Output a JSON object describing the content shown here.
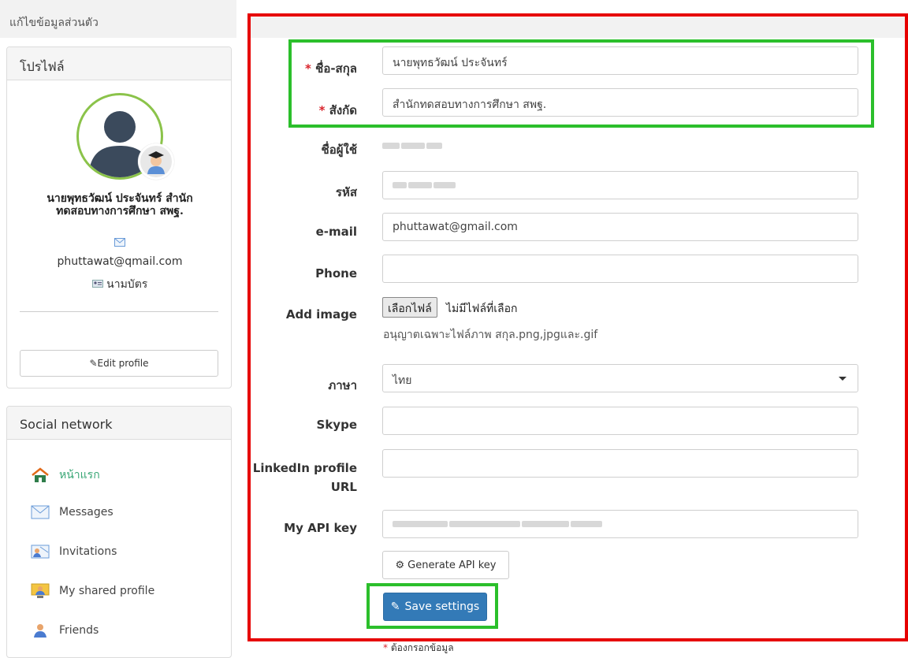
{
  "breadcrumb": "แก้ไขข้อมูลส่วนตัว",
  "profile_panel": {
    "title": "โปรไฟล์",
    "name_line1": "นายพุทธวัฒน์ ประจันทร์ สำนัก",
    "name_line2": "ทดสอบทางการศึกษา สพฐ.",
    "email": "phuttawat@qmail.com",
    "card_label": "นามบัตร",
    "edit_button": "Edit profile"
  },
  "social_panel": {
    "title": "Social network",
    "items": [
      {
        "label": "หน้าแรก",
        "icon": "home-icon"
      },
      {
        "label": "Messages",
        "icon": "envelope-icon"
      },
      {
        "label": "Invitations",
        "icon": "invitation-icon"
      },
      {
        "label": "My shared profile",
        "icon": "shared-profile-icon"
      },
      {
        "label": "Friends",
        "icon": "friends-icon"
      }
    ]
  },
  "form": {
    "fullname": {
      "label": "ชื่อ-สกุล",
      "required_mark": "*",
      "value": "นายพุทธวัฒน์ ประจันทร์"
    },
    "affiliation": {
      "label": "สังกัด",
      "required_mark": "*",
      "value": "สำนักทดสอบทางการศึกษา สพฐ."
    },
    "username": {
      "label": "ชื่อผู้ใช้"
    },
    "password": {
      "label": "รหัส"
    },
    "email": {
      "label": "e-mail",
      "value": "phuttawat@gmail.com"
    },
    "phone": {
      "label": "Phone",
      "value": ""
    },
    "image": {
      "label": "Add image",
      "button": "เลือกไฟล์",
      "status": "ไม่มีไฟล์ที่เลือก",
      "help": "อนุญาตเฉพาะไฟล์ภาพ สกุล.png,jpgและ.gif"
    },
    "language": {
      "label": "ภาษา",
      "value": "ไทย"
    },
    "skype": {
      "label": "Skype",
      "value": ""
    },
    "linkedin": {
      "label_line1": "LinkedIn profile",
      "label_line2": "URL",
      "value": ""
    },
    "api_key": {
      "label": "My API key"
    },
    "generate_button": "Generate API key",
    "save_button": "Save settings",
    "required_note_mark": "*",
    "required_note": "ต้องกรอกข้อมูล"
  },
  "colors": {
    "annotation_red": "#e60000",
    "annotation_green": "#2bbf2b",
    "primary": "#337ab7",
    "required": "#d9242c",
    "active_link": "#3aa776"
  }
}
